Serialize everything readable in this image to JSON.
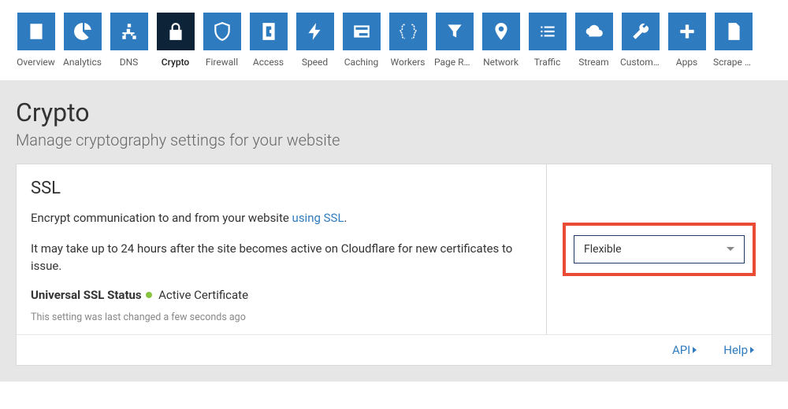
{
  "nav": {
    "items": [
      {
        "id": "overview",
        "label": "Overview"
      },
      {
        "id": "analytics",
        "label": "Analytics"
      },
      {
        "id": "dns",
        "label": "DNS"
      },
      {
        "id": "crypto",
        "label": "Crypto",
        "active": true
      },
      {
        "id": "firewall",
        "label": "Firewall"
      },
      {
        "id": "access",
        "label": "Access"
      },
      {
        "id": "speed",
        "label": "Speed"
      },
      {
        "id": "caching",
        "label": "Caching"
      },
      {
        "id": "workers",
        "label": "Workers"
      },
      {
        "id": "page-rules",
        "label": "Page Rules"
      },
      {
        "id": "network",
        "label": "Network"
      },
      {
        "id": "traffic",
        "label": "Traffic"
      },
      {
        "id": "stream",
        "label": "Stream"
      },
      {
        "id": "custom",
        "label": "Custom ..."
      },
      {
        "id": "apps",
        "label": "Apps"
      },
      {
        "id": "scrape",
        "label": "Scrape S..."
      }
    ]
  },
  "page": {
    "title": "Crypto",
    "subtitle": "Manage cryptography settings for your website"
  },
  "ssl": {
    "title": "SSL",
    "desc_prefix": "Encrypt communication to and from your website ",
    "desc_link": "using SSL",
    "desc_suffix": ".",
    "note": "It may take up to 24 hours after the site becomes active on Cloudflare for new certificates to issue.",
    "status_label": "Universal SSL Status",
    "status_value": "Active Certificate",
    "status_color": "#86c440",
    "last_changed": "This setting was last changed a few seconds ago",
    "selected_option": "Flexible"
  },
  "footer": {
    "api": "API",
    "help": "Help"
  }
}
